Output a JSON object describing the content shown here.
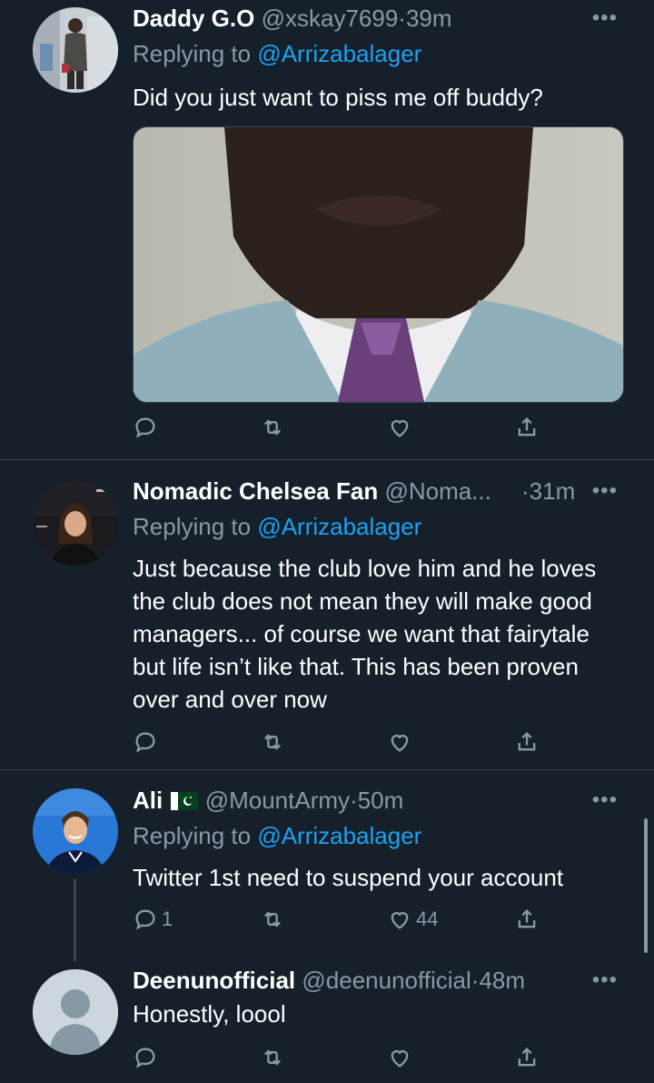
{
  "tweets": [
    {
      "name": "Daddy G.O",
      "handle": "@xskay7699",
      "time": "39m",
      "replying_prefix": "Replying to",
      "replying_to": "@Arrizabalager",
      "text": "Did you just want to piss me off buddy?",
      "reply_count": "",
      "retweet_count": "",
      "like_count": ""
    },
    {
      "name": "Nomadic Chelsea Fan",
      "handle": "@Noma...",
      "time": "31m",
      "replying_prefix": "Replying to",
      "replying_to": "@Arrizabalager",
      "text": "Just because the club love him and he loves the club does not mean they will make good managers... of course we want that fairytale but life isn’t like that. This has been proven over and over now",
      "reply_count": "",
      "retweet_count": "",
      "like_count": ""
    },
    {
      "name": "Ali",
      "handle": "@MountArmy",
      "time": "50m",
      "replying_prefix": "Replying to",
      "replying_to": "@Arrizabalager",
      "text": "Twitter 1st need to suspend your account",
      "reply_count": "1",
      "retweet_count": "",
      "like_count": "44"
    },
    {
      "name": "Deenunofficial",
      "handle": "@deenunofficial",
      "time": "48m",
      "text": "Honestly, loool",
      "reply_count": "",
      "retweet_count": "",
      "like_count": ""
    }
  ],
  "separator": "·",
  "more_label": "•••",
  "icons": {
    "reply": "reply-icon",
    "retweet": "retweet-icon",
    "like": "heart-icon",
    "share": "share-icon"
  },
  "colors": {
    "background": "#15202b",
    "muted": "#8899a6",
    "link": "#1da1f2",
    "divider": "#38444d"
  }
}
